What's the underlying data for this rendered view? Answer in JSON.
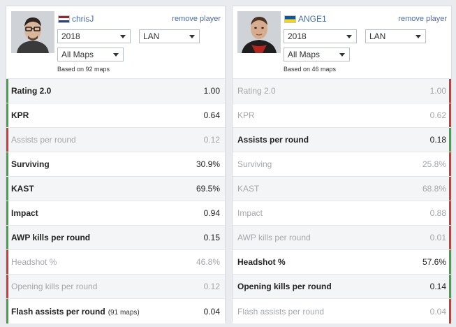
{
  "colors": {
    "win": "#3fa53f",
    "loss": "#d9372f",
    "link": "#4a6da7"
  },
  "players": [
    {
      "name": "chrisJ",
      "flag": "nl",
      "remove": "remove player",
      "year": "2018",
      "event": "LAN",
      "maps": "All Maps",
      "based_on": "Based on 92 maps",
      "stats": [
        {
          "label": "Rating 2.0",
          "value": "1.00",
          "result": "win"
        },
        {
          "label": "KPR",
          "value": "0.64",
          "result": "win"
        },
        {
          "label": "Assists per round",
          "value": "0.12",
          "result": "loss"
        },
        {
          "label": "Surviving",
          "value": "30.9%",
          "result": "win"
        },
        {
          "label": "KAST",
          "value": "69.5%",
          "result": "win"
        },
        {
          "label": "Impact",
          "value": "0.94",
          "result": "win"
        },
        {
          "label": "AWP kills per round",
          "value": "0.15",
          "result": "win"
        },
        {
          "label": "Headshot %",
          "value": "46.8%",
          "result": "loss"
        },
        {
          "label": "Opening kills per round",
          "value": "0.12",
          "result": "loss"
        },
        {
          "label": "Flash assists per round",
          "note": "(91 maps)",
          "value": "0.04",
          "result": "win"
        }
      ]
    },
    {
      "name": "ANGE1",
      "flag": "ua",
      "remove": "remove player",
      "year": "2018",
      "event": "LAN",
      "maps": "All Maps",
      "based_on": "Based on 46 maps",
      "stats": [
        {
          "label": "Rating 2.0",
          "value": "1.00",
          "result": "loss"
        },
        {
          "label": "KPR",
          "value": "0.62",
          "result": "loss"
        },
        {
          "label": "Assists per round",
          "value": "0.18",
          "result": "win"
        },
        {
          "label": "Surviving",
          "value": "25.8%",
          "result": "loss"
        },
        {
          "label": "KAST",
          "value": "68.8%",
          "result": "loss"
        },
        {
          "label": "Impact",
          "value": "0.88",
          "result": "loss"
        },
        {
          "label": "AWP kills per round",
          "value": "0.01",
          "result": "loss"
        },
        {
          "label": "Headshot %",
          "value": "57.6%",
          "result": "win"
        },
        {
          "label": "Opening kills per round",
          "value": "0.14",
          "result": "win"
        },
        {
          "label": "Flash assists per round",
          "value": "0.04",
          "result": "loss"
        }
      ]
    }
  ]
}
